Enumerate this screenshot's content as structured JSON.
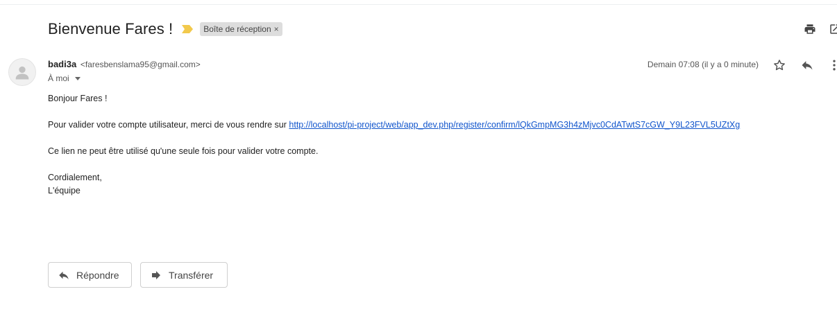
{
  "header": {
    "subject": "Bienvenue Fares !",
    "importance_icon": "importance-marker-icon",
    "label": "Boîte de réception",
    "label_remove": "×",
    "print_icon": "print-icon",
    "open_new_window_icon": "open-in-new-window-icon",
    "colors": {
      "importance": "#f2c94c",
      "label_bg": "#dddddd",
      "link": "#1155cc"
    }
  },
  "message": {
    "sender_name": "badi3a",
    "sender_email": "<faresbenslama95@gmail.com>",
    "recipient": "À moi",
    "date": "Demain 07:08 (il y a 0 minute)",
    "avatar_icon": "default-avatar-icon",
    "star_icon": "star-icon",
    "reply_icon": "reply-icon",
    "more_icon": "more-vert-icon",
    "body": {
      "greeting": "Bonjour Fares !",
      "line1_text": "Pour valider votre compte utilisateur, merci de vous rendre sur ",
      "line1_link": "http://localhost/pi-project/web/app_dev.php/register/confirm/lQkGmpMG3h4zMjvc0CdATwtS7cGW_Y9L23FVL5UZtXg",
      "line2": "Ce lien ne peut être utilisé qu'une seule fois pour valider votre compte.",
      "closing": "Cordialement,",
      "signature": "L'équipe"
    }
  },
  "actions": {
    "reply_label": "Répondre",
    "forward_label": "Transférer"
  }
}
